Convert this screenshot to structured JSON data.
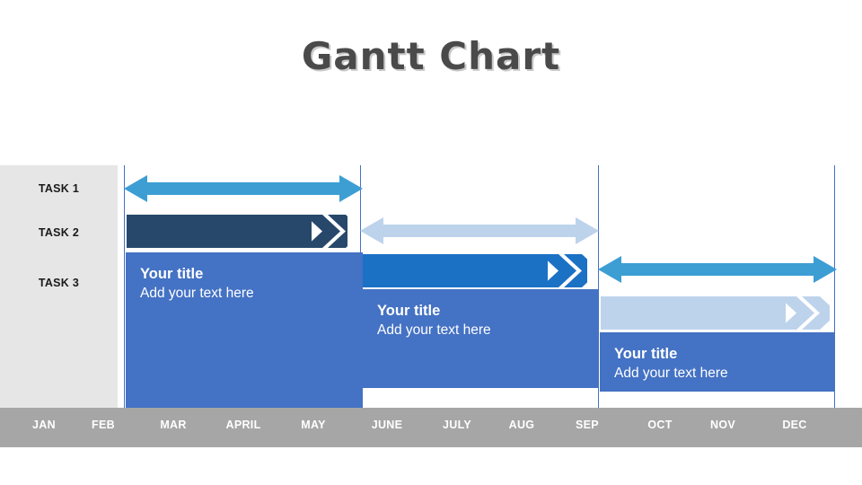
{
  "slide": {
    "title": "Gantt Chart",
    "background_color": "#ffffff"
  },
  "tasks": {
    "column_background": "#e6e6e6",
    "items": [
      {
        "label": "TASK 1"
      },
      {
        "label": "TASK 2"
      },
      {
        "label": "TASK 3"
      }
    ]
  },
  "timeline": {
    "bar_color": "#a6a6a6",
    "months": [
      {
        "label": "JAN"
      },
      {
        "label": "FEB"
      },
      {
        "label": "MAR"
      },
      {
        "label": "APRIL"
      },
      {
        "label": "MAY"
      },
      {
        "label": "JUNE"
      },
      {
        "label": "JULY"
      },
      {
        "label": "AUG"
      },
      {
        "label": "SEP"
      },
      {
        "label": "OCT"
      },
      {
        "label": "NOV"
      },
      {
        "label": "DEC"
      }
    ]
  },
  "bars": [
    {
      "name": "task1-bar",
      "color": "#3d9ed4",
      "style": "double-arrow",
      "row": 1,
      "start_month": "FEB",
      "end_month": "APRIL"
    },
    {
      "name": "task2-bar-dark",
      "color": "#27486b",
      "style": "chevron-right",
      "row": 2,
      "start_month": "FEB",
      "end_month": "APRIL"
    },
    {
      "name": "task2-bar-light",
      "color": "#bdd3ec",
      "style": "double-arrow",
      "row": 2,
      "start_month": "MAY",
      "end_month": "JULY"
    },
    {
      "name": "task3-bar-blue",
      "color": "#1b71c4",
      "style": "chevron-right",
      "row": 3,
      "start_month": "MAY",
      "end_month": "JULY"
    },
    {
      "name": "task3-bar-teal",
      "color": "#3d9ed4",
      "style": "double-arrow",
      "row": 3,
      "start_month": "AUG",
      "end_month": "NOV"
    },
    {
      "name": "task4-bar-light",
      "color": "#bdd3ec",
      "style": "chevron-right",
      "row": 4,
      "start_month": "AUG",
      "end_month": "OCT"
    }
  ],
  "callouts": [
    {
      "name": "callout-1",
      "color": "#4472c4",
      "title": "Your title",
      "body": "Add your text here"
    },
    {
      "name": "callout-2",
      "color": "#4472c4",
      "title": "Your title",
      "body": "Add your text here"
    },
    {
      "name": "callout-3",
      "color": "#4472c4",
      "title": "Your title",
      "body": "Add your text here"
    }
  ],
  "colors": {
    "teal": "#3d9ed4",
    "navy": "#27486b",
    "light_blue": "#bdd3ec",
    "blue": "#1b71c4",
    "callout_blue": "#4472c4",
    "grid_line": "#4472c4",
    "task_panel": "#e6e6e6",
    "month_bar": "#a6a6a6"
  }
}
